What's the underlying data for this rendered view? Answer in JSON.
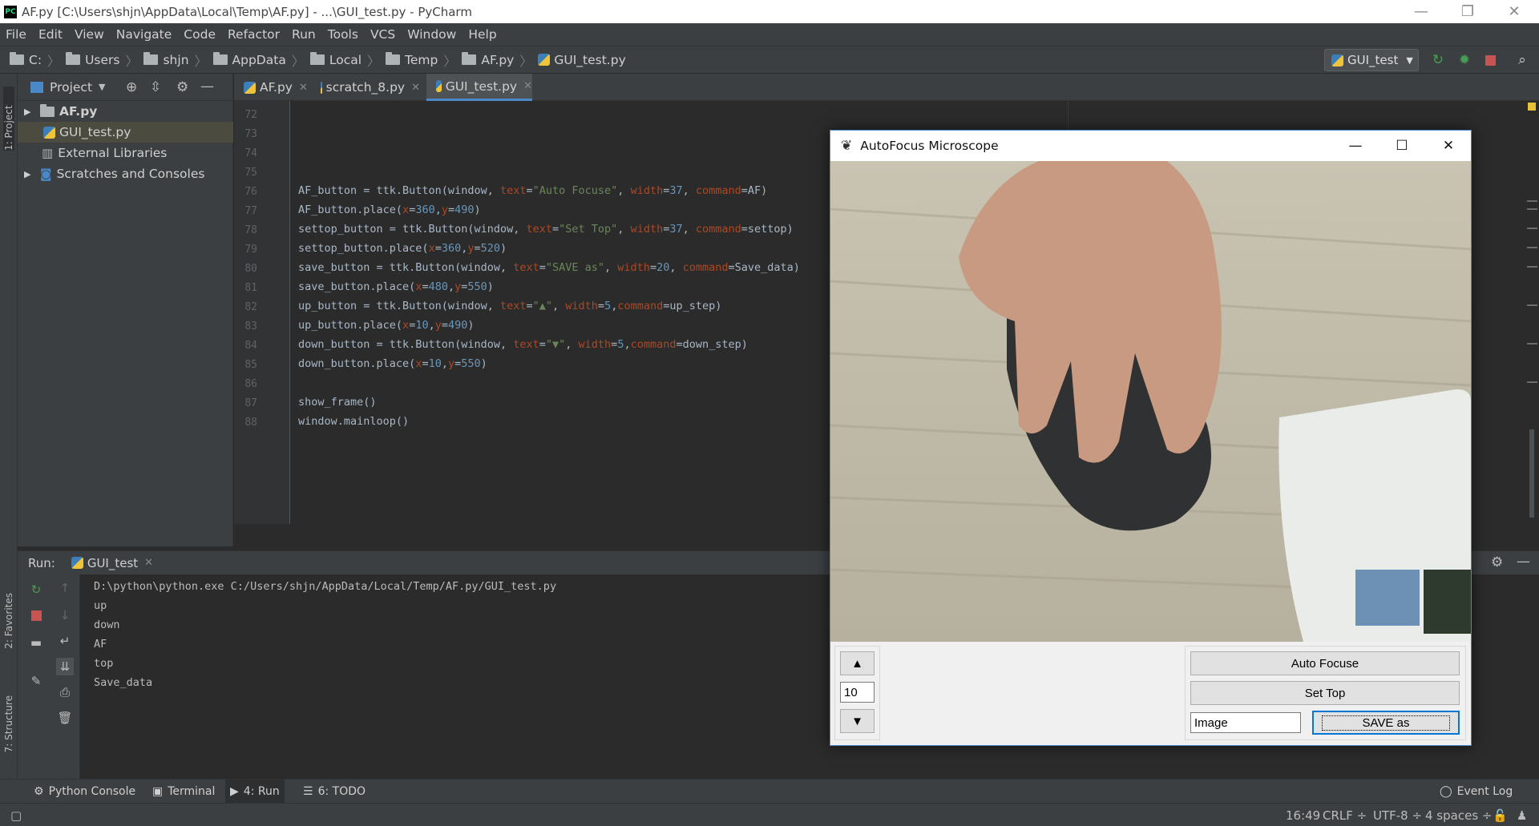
{
  "window": {
    "title": "AF.py [C:\\Users\\shjn\\AppData\\Local\\Temp\\AF.py] - ...\\GUI_test.py - PyCharm",
    "app_icon_text": "PC"
  },
  "menu": [
    "File",
    "Edit",
    "View",
    "Navigate",
    "Code",
    "Refactor",
    "Run",
    "Tools",
    "VCS",
    "Window",
    "Help"
  ],
  "breadcrumbs": [
    "C:",
    "Users",
    "shjn",
    "AppData",
    "Local",
    "Temp",
    "AF.py",
    "GUI_test.py"
  ],
  "run_config": "GUI_test",
  "left_stripe": {
    "project": "1: Project",
    "favorites": "2: Favorites",
    "structure": "7: Structure"
  },
  "project_panel": {
    "title": "Project",
    "items": [
      {
        "label": "AF.py",
        "type": "folder",
        "expanded": false
      },
      {
        "label": "GUI_test.py",
        "type": "file",
        "selected": true
      },
      {
        "label": "External Libraries",
        "type": "library"
      },
      {
        "label": "Scratches and Consoles",
        "type": "scratches",
        "expanded": false
      }
    ]
  },
  "editor_tabs": [
    {
      "label": "AF.py",
      "active": false
    },
    {
      "label": "scratch_8.py",
      "active": false
    },
    {
      "label": "GUI_test.py",
      "active": true
    }
  ],
  "editor": {
    "lines": [
      {
        "n": "72",
        "text": ""
      },
      {
        "n": "73",
        "text": ""
      },
      {
        "n": "74",
        "text": ""
      },
      {
        "n": "75",
        "text": ""
      },
      {
        "n": "76",
        "text": "AF_button = ttk.Button(window, text=\"Auto Focuse\", width=37, command=AF)"
      },
      {
        "n": "77",
        "text": "AF_button.place(x=360,y=490)"
      },
      {
        "n": "78",
        "text": "settop_button = ttk.Button(window, text=\"Set Top\", width=37, command=settop)"
      },
      {
        "n": "79",
        "text": "settop_button.place(x=360,y=520)"
      },
      {
        "n": "80",
        "text": "save_button = ttk.Button(window, text=\"SAVE as\", width=20, command=Save_data)"
      },
      {
        "n": "81",
        "text": "save_button.place(x=480,y=550)"
      },
      {
        "n": "82",
        "text": "up_button = ttk.Button(window, text=\"▲\", width=5,command=up_step)"
      },
      {
        "n": "83",
        "text": "up_button.place(x=10,y=490)"
      },
      {
        "n": "84",
        "text": "down_button = ttk.Button(window, text=\"▼\", width=5,command=down_step)"
      },
      {
        "n": "85",
        "text": "down_button.place(x=10,y=550)"
      },
      {
        "n": "86",
        "text": ""
      },
      {
        "n": "87",
        "text": "show_frame()"
      },
      {
        "n": "88",
        "text": "window.mainloop()"
      }
    ]
  },
  "run_panel": {
    "label": "Run:",
    "tab": "GUI_test",
    "output": [
      "D:\\python\\python.exe C:/Users/shjn/AppData/Local/Temp/AF.py/GUI_test.py",
      "up",
      "down",
      "AF",
      "top",
      "Save_data"
    ]
  },
  "bottom_tools": [
    {
      "label": "Python Console",
      "active": false
    },
    {
      "label": "Terminal",
      "active": false
    },
    {
      "label": "4: Run",
      "active": true
    },
    {
      "label": "6: TODO",
      "active": false
    }
  ],
  "event_log": "Event Log",
  "status": {
    "position": "16:49",
    "line_sep": "CRLF ÷",
    "encoding": "UTF-8 ÷",
    "indent": "4 spaces ÷"
  },
  "tk_app": {
    "title": "AutoFocus Microscope",
    "up_label": "▲",
    "down_label": "▼",
    "step_value": "10",
    "auto_focus_label": "Auto Focuse",
    "set_top_label": "Set Top",
    "filename_value": "Image",
    "save_label": "SAVE as"
  },
  "colors": {
    "accent": "#4a88c7",
    "keyword": "#aa4926",
    "string": "#6a8759",
    "number": "#6897bb",
    "run_green": "#499c54",
    "stop_red": "#c75450"
  }
}
